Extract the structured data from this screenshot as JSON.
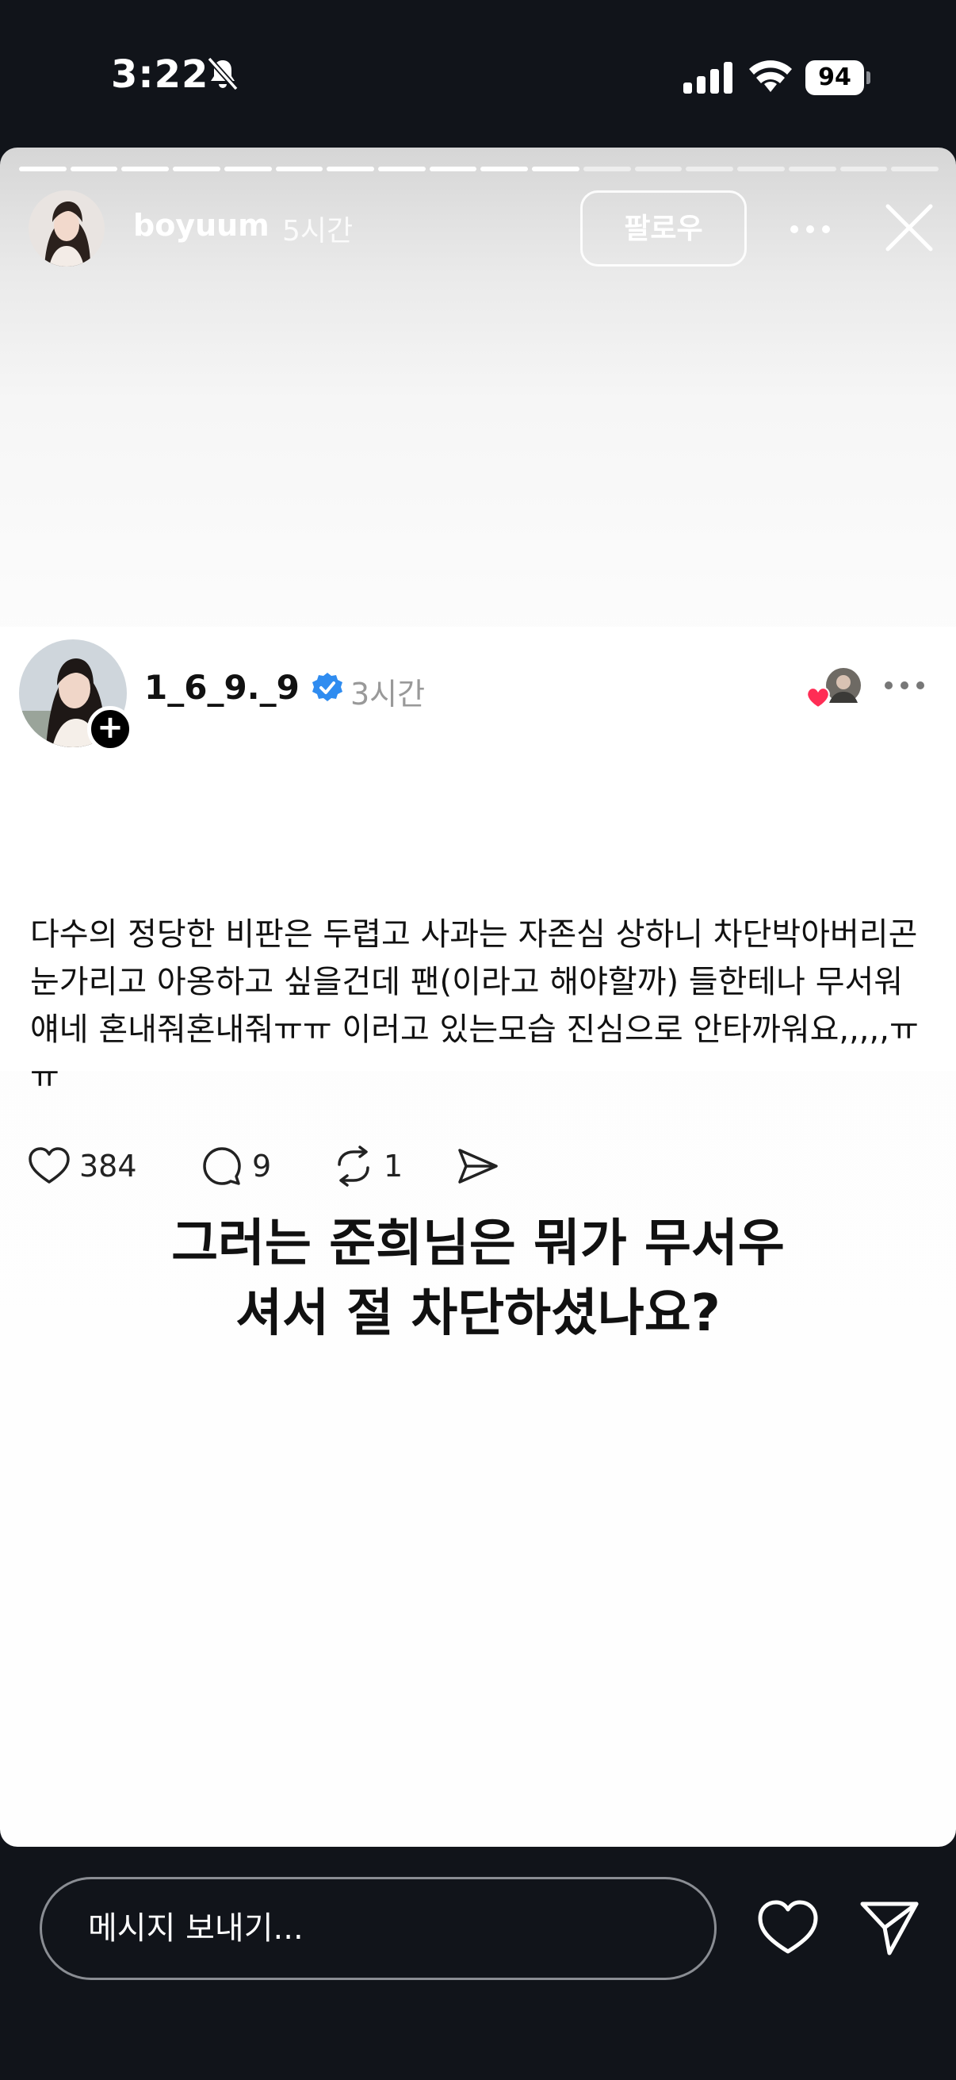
{
  "status_bar": {
    "time": "3:22",
    "battery": "94"
  },
  "story": {
    "username": "boyuum",
    "time_ago": "5시간",
    "follow_label": "팔로우",
    "progress_total_segments": 18,
    "progress_completed_segments": 11
  },
  "post": {
    "username": "1_6_9._9",
    "time_ago": "3시간",
    "text": "다수의 정당한 비판은 두렵고 사과는 자존심 상하니 차단박아버리곤 눈가리고 아옹하고 싶을건데 팬(이라고 해야할까) 들한테나 무서워 얘네 혼내줘혼내줘ㅠㅠ 이러고 있는모습 진심으로 안타까워요,,,,,ㅠㅠ",
    "likes": "384",
    "comments": "9",
    "reposts": "1"
  },
  "caption": {
    "line1": "그러는 준희님은 뭐가 무서우",
    "line2": "셔서 절 차단하셨나요?"
  },
  "bottom_bar": {
    "message_placeholder": "메시지 보내기..."
  },
  "colors": {
    "background": "#11141a",
    "verified": "#2f8cf0",
    "heart": "#ff2d55"
  }
}
